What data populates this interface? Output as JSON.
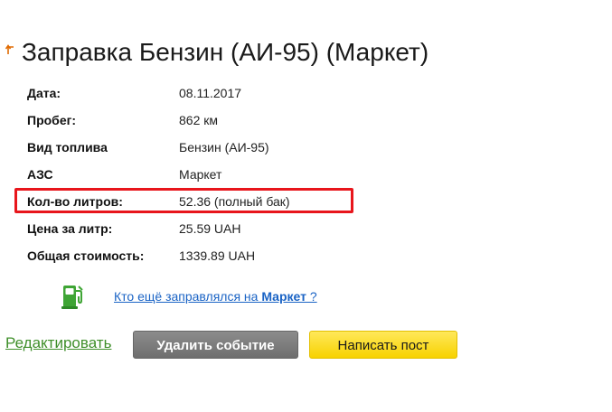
{
  "page": {
    "title": "Заправка Бензин (АИ-95) (Маркет)",
    "back_icon": "up-left-arrow-icon"
  },
  "details": [
    {
      "label": "Дата:",
      "value": "08.11.2017"
    },
    {
      "label": "Пробег:",
      "value": "862 км"
    },
    {
      "label": "Вид топлива",
      "value": "Бензин (АИ-95)"
    },
    {
      "label": "АЗС",
      "value": "Маркет"
    },
    {
      "label": "Кол-во литров:",
      "value": "52.36 (полный бак)"
    },
    {
      "label": "Цена за литр:",
      "value": "25.59 UAH"
    },
    {
      "label": "Общая стоимость:",
      "value": "1339.89 UAH"
    }
  ],
  "highlight": {
    "color": "#e8161c",
    "row_index": 4
  },
  "who_refueled": {
    "icon": "fuel-pump-icon",
    "prefix": "Кто ещё заправлялся на ",
    "station": "Маркет",
    "suffix": " ?"
  },
  "actions": {
    "edit_label": "Редактировать",
    "delete_label": "Удалить событие",
    "post_label": "Написать пост"
  },
  "colors": {
    "link": "#1a63c5",
    "edit_link": "#3f8f2a",
    "delete_button": "#7a7a7a",
    "post_button": "#f7d200"
  }
}
